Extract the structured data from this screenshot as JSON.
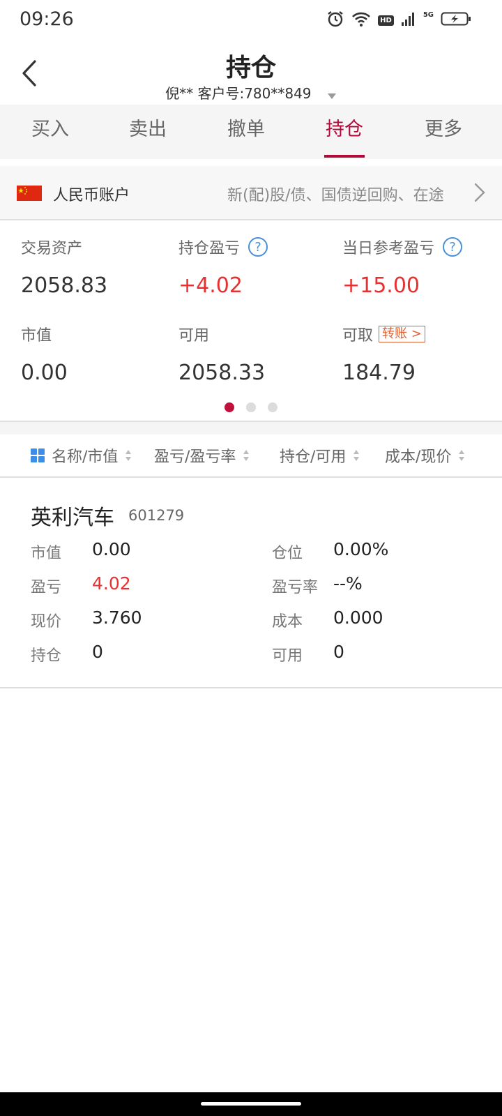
{
  "status_bar": {
    "time": "09:26",
    "hd": "HD",
    "network": "5G"
  },
  "header": {
    "title": "持仓",
    "account_line": "倪** 客户号:780**849"
  },
  "tabs": [
    {
      "label": "买入"
    },
    {
      "label": "卖出"
    },
    {
      "label": "撤单"
    },
    {
      "label": "持仓",
      "active": true
    },
    {
      "label": "更多"
    }
  ],
  "account": {
    "name": "人民币账户",
    "description": "新(配)股/债、国债逆回购、在途"
  },
  "summary": {
    "trade_assets": {
      "label": "交易资产",
      "value": "2058.83"
    },
    "position_pnl": {
      "label": "持仓盈亏",
      "value": "+4.02"
    },
    "daily_pnl": {
      "label": "当日参考盈亏",
      "value": "+15.00"
    },
    "market_value": {
      "label": "市值",
      "value": "0.00"
    },
    "available": {
      "label": "可用",
      "value": "2058.33"
    },
    "withdrawable": {
      "label": "可取",
      "value": "184.79",
      "transfer_label": "转账 >"
    },
    "page_indicator": {
      "current": 1,
      "total": 3
    }
  },
  "columns": [
    {
      "label": "名称/市值"
    },
    {
      "label": "盈亏/盈亏率"
    },
    {
      "label": "持仓/可用"
    },
    {
      "label": "成本/现价"
    }
  ],
  "holdings": [
    {
      "name": "英利汽车",
      "code": "601279",
      "fields": {
        "market_value": {
          "label": "市值",
          "value": "0.00"
        },
        "position_ratio": {
          "label": "仓位",
          "value": "0.00%"
        },
        "pnl": {
          "label": "盈亏",
          "value": "4.02"
        },
        "pnl_rate": {
          "label": "盈亏率",
          "value": "--%"
        },
        "price": {
          "label": "现价",
          "value": "3.760"
        },
        "cost": {
          "label": "成本",
          "value": "0.000"
        },
        "holding": {
          "label": "持仓",
          "value": "0"
        },
        "available": {
          "label": "可用",
          "value": "0"
        }
      }
    }
  ],
  "colors": {
    "accent": "#b0093a",
    "positive": "#e93030",
    "link": "#4a90d9",
    "transfer": "#e06030"
  }
}
